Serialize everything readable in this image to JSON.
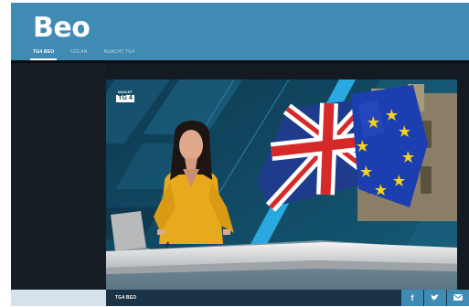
{
  "header": {
    "logo": "Beo",
    "tabs": [
      {
        "label": "TG4 BEO",
        "active": true
      },
      {
        "label": "COLAN",
        "active": false
      },
      {
        "label": "NUACHT TG4",
        "active": false
      }
    ]
  },
  "player": {
    "channel_logo": {
      "top": "NUACHT",
      "main": "TG 4"
    }
  },
  "footer": {
    "title": "TG4 BEO",
    "share": {
      "facebook_label": "f"
    }
  },
  "colors": {
    "brand_blue": "#3f8bb3",
    "page_dark": "#141a21",
    "studio_teal": "#0f3a52",
    "accent_cyan": "#2aa9e0",
    "presenter_top": "#e7aa1c"
  },
  "icons": [
    "facebook-icon",
    "twitter-icon",
    "email-icon"
  ]
}
